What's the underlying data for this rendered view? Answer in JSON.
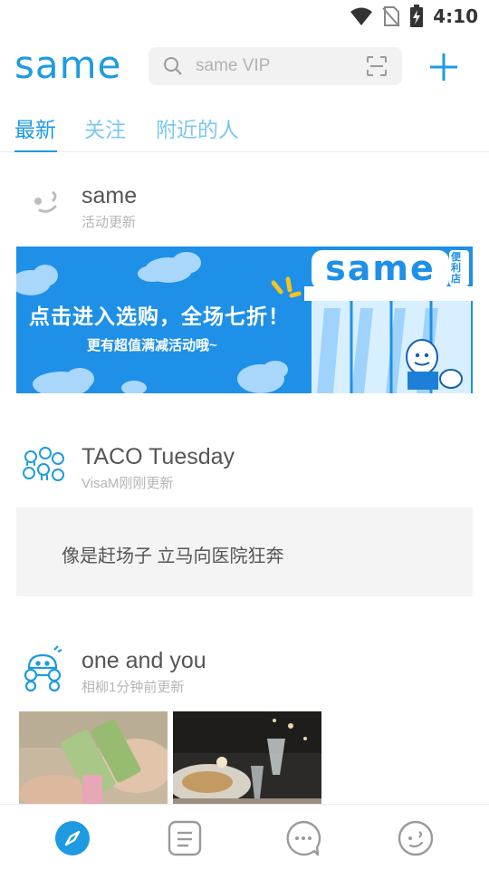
{
  "status_bar": {
    "time": "4:10",
    "icons": [
      "wifi-icon",
      "no-sim-icon",
      "battery-charging-icon"
    ]
  },
  "header": {
    "logo": "same",
    "search": {
      "placeholder": "same VIP",
      "icons": [
        "search-icon",
        "scan-icon"
      ]
    },
    "add_icon": "plus-icon"
  },
  "tabs": [
    {
      "label": "最新",
      "active": true
    },
    {
      "label": "关注",
      "active": false
    },
    {
      "label": "附近的人",
      "active": false
    }
  ],
  "feed": [
    {
      "name": "same",
      "subtitle": "活动更新",
      "banner": {
        "headline": "点击进入选购，全场七折！",
        "subline": "更有超值满减活动哦~",
        "store_logo": "same",
        "store_tag": "便利店"
      }
    },
    {
      "name": "TACO Tuesday",
      "subtitle": "VisaM刚刚更新",
      "text": "像是赶场子 立马向医院狂奔"
    },
    {
      "name": "one and you",
      "subtitle": "相柳1分钟前更新",
      "photos": [
        "photo-ice-pops",
        "photo-dinner-table"
      ]
    }
  ],
  "bottom_nav": [
    {
      "icon": "compass-icon",
      "active": true
    },
    {
      "icon": "list-icon",
      "active": false
    },
    {
      "icon": "chat-icon",
      "active": false
    },
    {
      "icon": "face-icon",
      "active": false
    }
  ],
  "colors": {
    "brand": "#1e9be0",
    "banner_bg": "#1e90e8",
    "tab_inactive": "#7cc8f0"
  }
}
